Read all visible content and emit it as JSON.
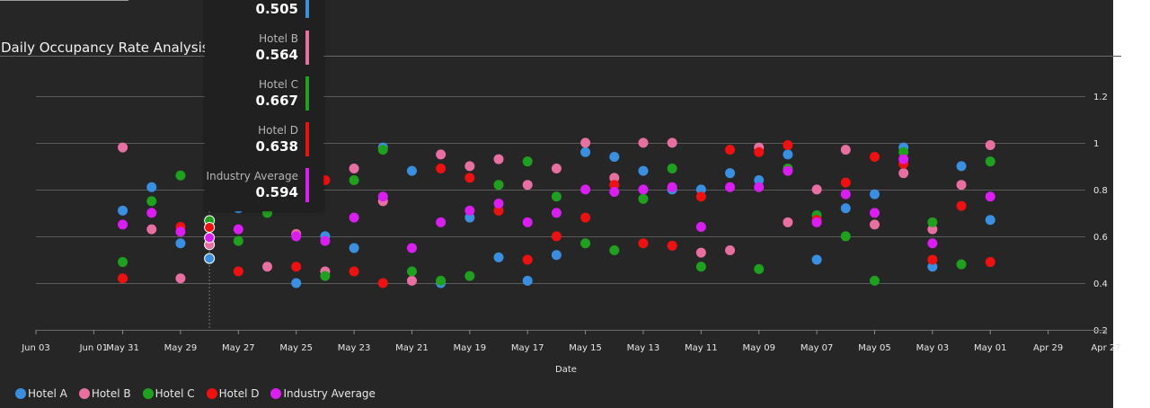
{
  "title": "Daily Occupancy Rate Analysis b",
  "title_tail": "4)",
  "colors": {
    "Hotel A": "#3b8fe0",
    "Hotel B": "#e86fa2",
    "Hotel C": "#1fa01f",
    "Hotel D": "#ee1111",
    "Industry Average": "#d81ff0"
  },
  "tooltip": {
    "rows": [
      {
        "label": "",
        "value": "0.505",
        "color": "#3b8fe0"
      },
      {
        "label": "Hotel B",
        "value": "0.564",
        "color": "#e86fa2"
      },
      {
        "label": "Hotel C",
        "value": "0.667",
        "color": "#1fa01f"
      },
      {
        "label": "Hotel D",
        "value": "0.638",
        "color": "#ee1111"
      },
      {
        "label": "Industry Average",
        "value": "0.594",
        "color": "#d81ff0"
      }
    ]
  },
  "chart_data": {
    "type": "scatter",
    "title": "Daily Occupancy Rate Analysis b… 4)",
    "xlabel": "Date",
    "ylabel": "",
    "x_axis": {
      "reversed": true,
      "range": [
        "2024-06-03",
        "2024-04-27"
      ],
      "tick_labels": [
        {
          "date": "2024-06-03",
          "label": "Jun 03"
        },
        {
          "date": "2024-06-01",
          "label": "Jun 01"
        },
        {
          "date": "2024-05-31",
          "label": "May 31"
        },
        {
          "date": "2024-05-29",
          "label": "May 29"
        },
        {
          "date": "2024-05-27",
          "label": "May 27"
        },
        {
          "date": "2024-05-25",
          "label": "May 25"
        },
        {
          "date": "2024-05-23",
          "label": "May 23"
        },
        {
          "date": "2024-05-21",
          "label": "May 21"
        },
        {
          "date": "2024-05-19",
          "label": "May 19"
        },
        {
          "date": "2024-05-17",
          "label": "May 17"
        },
        {
          "date": "2024-05-15",
          "label": "May 15"
        },
        {
          "date": "2024-05-13",
          "label": "May 13"
        },
        {
          "date": "2024-05-11",
          "label": "May 11"
        },
        {
          "date": "2024-05-09",
          "label": "May 09"
        },
        {
          "date": "2024-05-07",
          "label": "May 07"
        },
        {
          "date": "2024-05-05",
          "label": "May 05"
        },
        {
          "date": "2024-05-03",
          "label": "May 03"
        },
        {
          "date": "2024-05-01",
          "label": "May 01"
        },
        {
          "date": "2024-04-29",
          "label": "Apr 29"
        },
        {
          "date": "2024-04-27",
          "label": "Apr 27"
        }
      ]
    },
    "y_axis": {
      "range": [
        0.2,
        1.38
      ],
      "position": "right",
      "ticks": [
        0.2,
        0.4,
        0.6,
        0.8,
        1,
        1.2
      ],
      "tick_labels": [
        "0.2",
        "0.4",
        "0.6",
        "0.8",
        "1",
        "1.2"
      ]
    },
    "grid": true,
    "legend": {
      "position": "bottom-left"
    },
    "hover_date": "2024-05-28",
    "x": [
      "2024-05-31",
      "2024-05-30",
      "2024-05-29",
      "2024-05-28",
      "2024-05-27",
      "2024-05-26",
      "2024-05-25",
      "2024-05-24",
      "2024-05-23",
      "2024-05-22",
      "2024-05-21",
      "2024-05-20",
      "2024-05-19",
      "2024-05-18",
      "2024-05-17",
      "2024-05-16",
      "2024-05-15",
      "2024-05-14",
      "2024-05-13",
      "2024-05-12",
      "2024-05-11",
      "2024-05-10",
      "2024-05-09",
      "2024-05-08",
      "2024-05-07",
      "2024-05-06",
      "2024-05-05",
      "2024-05-04",
      "2024-05-03",
      "2024-05-02",
      "2024-05-01"
    ],
    "series": [
      {
        "name": "Hotel A",
        "values": [
          0.71,
          0.81,
          0.57,
          0.505,
          0.72,
          0.73,
          0.4,
          0.6,
          0.55,
          0.98,
          0.88,
          0.4,
          0.68,
          0.51,
          0.41,
          0.52,
          0.96,
          0.94,
          0.88,
          0.8,
          0.8,
          0.87,
          0.84,
          0.95,
          0.5,
          0.72,
          0.78,
          0.98,
          0.47,
          0.9,
          0.67
        ]
      },
      {
        "name": "Hotel B",
        "values": [
          0.98,
          0.63,
          0.42,
          0.564,
          null,
          0.47,
          0.61,
          0.45,
          0.89,
          0.75,
          0.41,
          0.95,
          0.9,
          0.93,
          0.82,
          0.89,
          1.0,
          0.85,
          1.0,
          1.0,
          0.53,
          0.54,
          0.98,
          0.66,
          0.8,
          0.97,
          0.65,
          0.87,
          0.63,
          0.82,
          0.99
        ]
      },
      {
        "name": "Hotel C",
        "values": [
          0.49,
          0.75,
          0.86,
          0.667,
          0.58,
          0.7,
          null,
          0.43,
          0.84,
          0.97,
          0.45,
          0.41,
          0.43,
          0.82,
          0.92,
          0.77,
          0.57,
          0.54,
          0.76,
          0.89,
          0.47,
          null,
          0.46,
          0.89,
          0.69,
          0.6,
          0.41,
          0.96,
          0.66,
          0.48,
          0.92
        ]
      },
      {
        "name": "Hotel D",
        "values": [
          0.42,
          null,
          0.64,
          0.638,
          0.45,
          null,
          0.47,
          0.84,
          0.45,
          0.4,
          null,
          0.89,
          0.85,
          0.71,
          0.5,
          0.6,
          0.68,
          0.82,
          0.57,
          0.56,
          0.77,
          0.97,
          0.96,
          0.99,
          0.67,
          0.83,
          0.94,
          0.91,
          0.5,
          0.73,
          0.49
        ]
      },
      {
        "name": "Industry Average",
        "values": [
          0.65,
          0.7,
          0.62,
          0.594,
          0.63,
          null,
          0.6,
          0.58,
          0.68,
          0.77,
          0.55,
          0.66,
          0.71,
          0.74,
          0.66,
          0.7,
          0.8,
          0.79,
          0.8,
          0.81,
          0.64,
          0.81,
          0.81,
          0.88,
          0.66,
          0.78,
          0.7,
          0.93,
          0.57,
          null,
          0.77
        ]
      }
    ]
  }
}
